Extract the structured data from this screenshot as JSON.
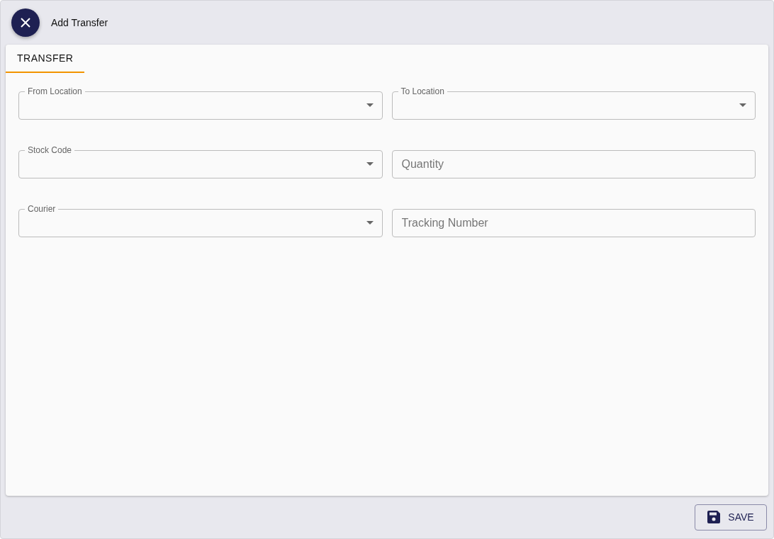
{
  "window": {
    "title": "Add Transfer"
  },
  "tabs": [
    {
      "label": "TRANSFER",
      "selected": true
    }
  ],
  "fields": [
    {
      "kind": "select",
      "label": "From Location"
    },
    {
      "kind": "select",
      "label": "To Location"
    },
    {
      "kind": "select",
      "label": "Stock Code"
    },
    {
      "kind": "text",
      "placeholder": "Quantity"
    },
    {
      "kind": "select",
      "label": "Courier"
    },
    {
      "kind": "text",
      "placeholder": "Tracking Number"
    }
  ],
  "buttons": [
    {
      "label": "SAVE"
    }
  ]
}
